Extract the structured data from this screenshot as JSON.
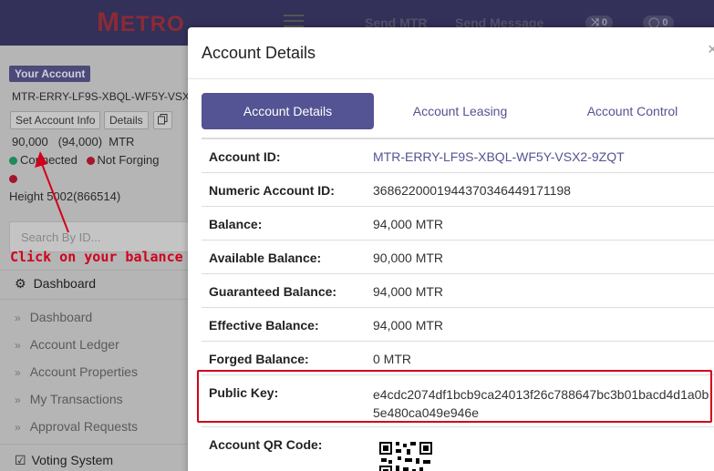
{
  "header": {
    "logo_text_first": "M",
    "logo_text_rest": "ETRO",
    "nav": [
      "Send MTR",
      "Send Message"
    ],
    "badges": [
      {
        "icon": "shuffle-icon",
        "glyph": "⤨",
        "count": "0"
      },
      {
        "icon": "chat-icon",
        "glyph": "◯",
        "count": "0"
      }
    ]
  },
  "sidebar": {
    "account_badge": "Your Account",
    "account_id": "MTR-ERRY-LF9S-XBQL-WF5Y-VSX",
    "buttons": [
      "Set Account Info",
      "Details"
    ],
    "balance_line": "90,000   (94,000)  MTR",
    "status_connected": "Connected",
    "status_forging": "Not Forging",
    "height": "Height 5002(866514)",
    "search_placeholder": "Search By ID...",
    "annotation": "Click on your balance",
    "section1": "Dashboard",
    "items": [
      "Dashboard",
      "Account Ledger",
      "Account Properties",
      "My Transactions",
      "Approval Requests"
    ],
    "section2": "Voting System",
    "colors": {
      "connected": "#1f8a5a",
      "forging": "#a3172b"
    }
  },
  "modal": {
    "title": "Account Details",
    "close": "×",
    "tabs": [
      "Account Details",
      "Account Leasing",
      "Account Control"
    ],
    "rows": [
      {
        "key": "Account ID:",
        "value": "MTR-ERRY-LF9S-XBQL-WF5Y-VSX2-9ZQT"
      },
      {
        "key": "Numeric Account ID:",
        "value": "3686220001944370346449171198"
      },
      {
        "key": "Balance:",
        "value": "94,000 MTR"
      },
      {
        "key": "Available Balance:",
        "value": "90,000 MTR"
      },
      {
        "key": "Guaranteed Balance:",
        "value": "94,000 MTR"
      },
      {
        "key": "Effective Balance:",
        "value": "94,000 MTR"
      },
      {
        "key": "Forged Balance:",
        "value": "0 MTR"
      },
      {
        "key": "Public Key:",
        "value": "e4cdc2074df1bcb9ca24013f26c788647bc3b01bacd4d1a0b5e480ca049e946e"
      },
      {
        "key": "Account QR Code:",
        "value": ""
      }
    ],
    "accent_color": "#545393",
    "highlight_color": "#d0021b"
  }
}
